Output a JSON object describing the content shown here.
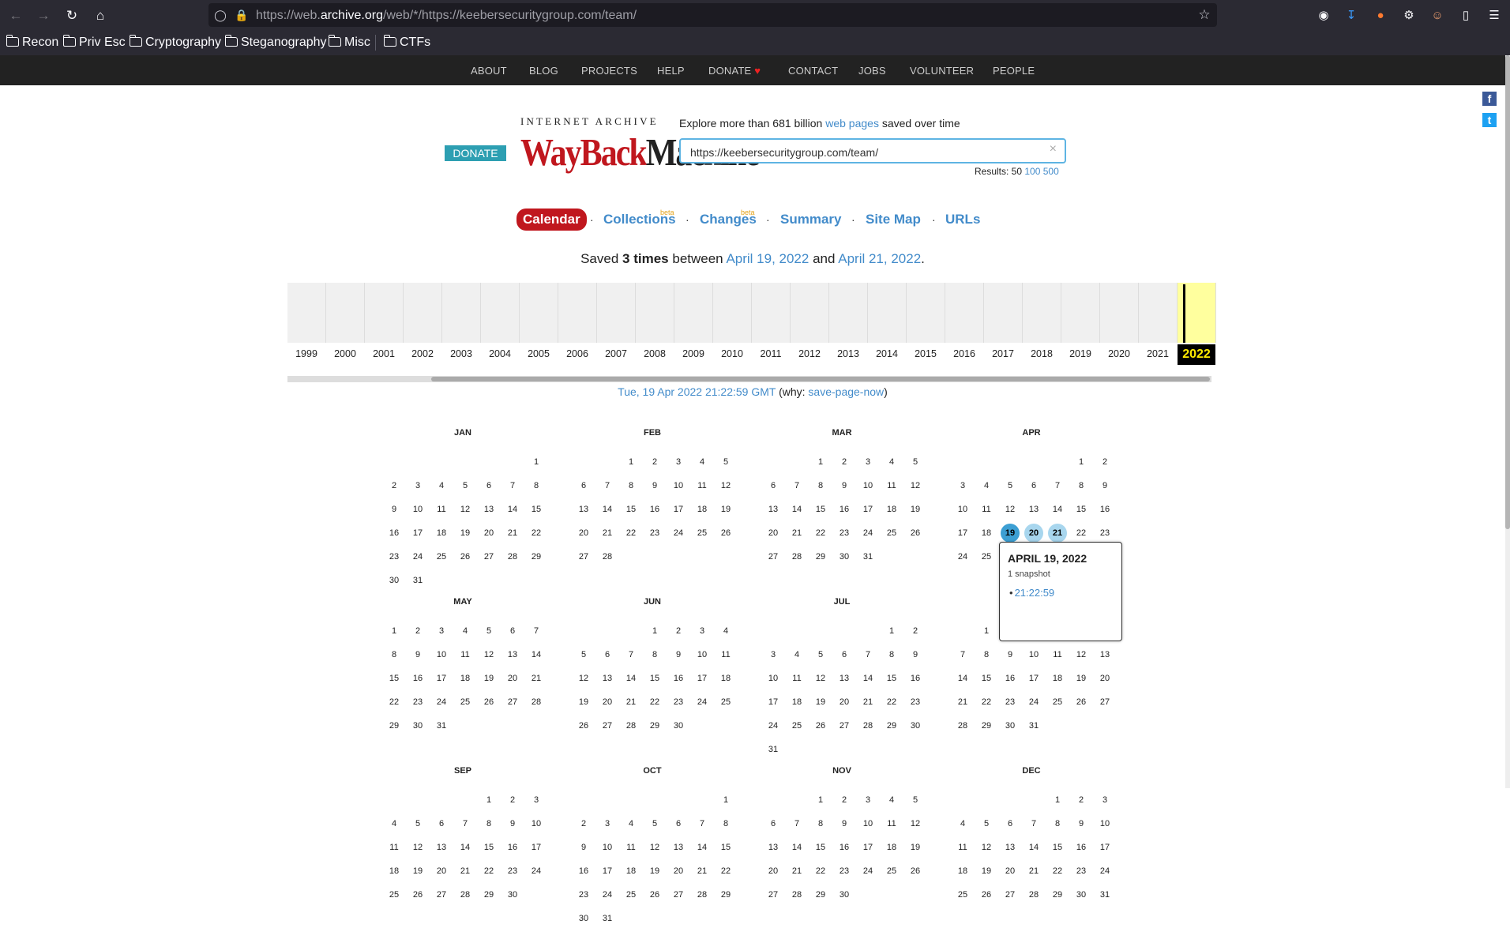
{
  "browser": {
    "url_host_prefix": "https://web.",
    "url_host_main": "archive.org",
    "url_path": "/web/*/https://keebersecuritygroup.com/team/",
    "bookmarks": [
      "Recon",
      "Priv Esc",
      "Cryptography",
      "Steganography",
      "Misc",
      "CTFs"
    ]
  },
  "topnav": [
    "ABOUT",
    "BLOG",
    "PROJECTS",
    "HELP",
    "DONATE",
    "CONTACT",
    "JOBS",
    "VOLUNTEER",
    "PEOPLE"
  ],
  "header": {
    "donate_label": "DONATE",
    "logo_top": "INTERNET ARCHIVE",
    "logo_wayback": "WayBack",
    "logo_machine": "Machine",
    "explore_pre": "Explore more than 681 billion",
    "explore_link": "web pages",
    "explore_post": "saved over time",
    "search_value": "https://keebersecuritygroup.com/team/",
    "search_clear": "×",
    "results_label": "Results: 50",
    "results_100": "100",
    "results_500": "500"
  },
  "tabs": [
    {
      "label": "Calendar",
      "active": true
    },
    {
      "label": "Collections",
      "beta": "beta"
    },
    {
      "label": "Changes",
      "beta": "beta"
    },
    {
      "label": "Summary"
    },
    {
      "label": "Site Map"
    },
    {
      "label": "URLs"
    }
  ],
  "saved": {
    "pre": "Saved",
    "count": "3 times",
    "mid": "between",
    "start": "April 19, 2022",
    "and": "and",
    "end": "April 21, 2022",
    "period": "."
  },
  "timeline": {
    "years": [
      "1999",
      "2000",
      "2001",
      "2002",
      "2003",
      "2004",
      "2005",
      "2006",
      "2007",
      "2008",
      "2009",
      "2010",
      "2011",
      "2012",
      "2013",
      "2014",
      "2015",
      "2016",
      "2017",
      "2018",
      "2019",
      "2020",
      "2021",
      "2022"
    ],
    "current_year": "2022"
  },
  "snapshot_info": {
    "time": "Tue, 19 Apr 2022 21:22:59 GMT",
    "why_pre": "(why:",
    "why_link": "save-page-now",
    "why_post": ")"
  },
  "calendar": {
    "months": [
      {
        "name": "JAN",
        "start": 6,
        "days": 31
      },
      {
        "name": "FEB",
        "start": 2,
        "days": 28
      },
      {
        "name": "MAR",
        "start": 2,
        "days": 31
      },
      {
        "name": "APR",
        "start": 5,
        "days": 30
      },
      {
        "name": "MAY",
        "start": 0,
        "days": 31
      },
      {
        "name": "JUN",
        "start": 3,
        "days": 30
      },
      {
        "name": "JUL",
        "start": 5,
        "days": 31
      },
      {
        "name": "AUG",
        "start": 1,
        "days": 31
      },
      {
        "name": "SEP",
        "start": 4,
        "days": 30
      },
      {
        "name": "OCT",
        "start": 6,
        "days": 31
      },
      {
        "name": "NOV",
        "start": 2,
        "days": 30
      },
      {
        "name": "DEC",
        "start": 4,
        "days": 31
      }
    ],
    "snapshot_days": {
      "APR": [
        19,
        20,
        21
      ]
    },
    "selected": {
      "month": "APR",
      "day": 19
    }
  },
  "popup": {
    "date": "APRIL 19, 2022",
    "count": "1 snapshot",
    "time": "21:22:59"
  }
}
